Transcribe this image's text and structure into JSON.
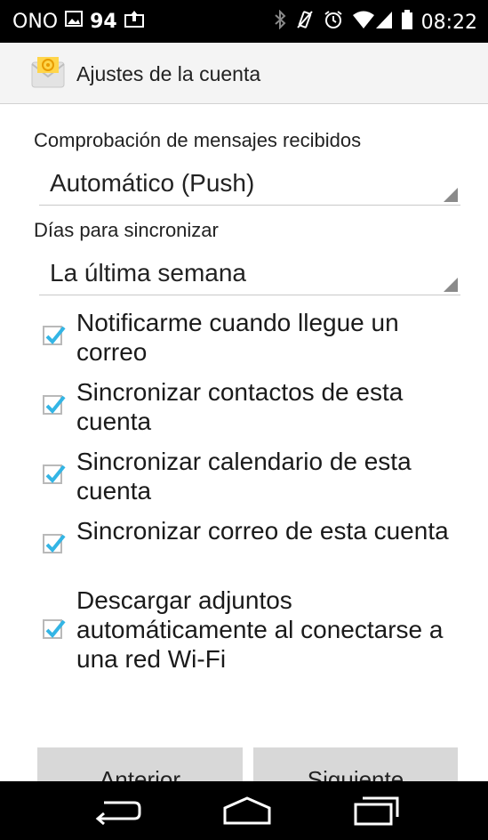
{
  "status_bar": {
    "carrier": "ONO",
    "count": "94",
    "time": "08:22"
  },
  "action_bar": {
    "title": "Ajustes de la cuenta",
    "icon": "email-app-icon"
  },
  "check_frequency": {
    "label": "Comprobación de mensajes recibidos",
    "value": "Automático (Push)"
  },
  "sync_days": {
    "label": "Días para sincronizar",
    "value": "La última semana"
  },
  "options": [
    {
      "label": "Notificarme cuando llegue un correo",
      "checked": true
    },
    {
      "label": "Sincronizar contactos de esta cuenta",
      "checked": true
    },
    {
      "label": "Sincronizar calendario de esta cuenta",
      "checked": true
    },
    {
      "label": "Sincronizar correo de esta cuenta",
      "checked": true
    },
    {
      "label": "Descargar adjuntos automáticamente al conectarse a una red Wi-Fi",
      "checked": true
    }
  ],
  "buttons": {
    "previous": "Anterior",
    "next": "Siguiente"
  },
  "colors": {
    "accent": "#33b5e5",
    "statusbar": "#000000",
    "actionbar": "#f4f4f4"
  }
}
